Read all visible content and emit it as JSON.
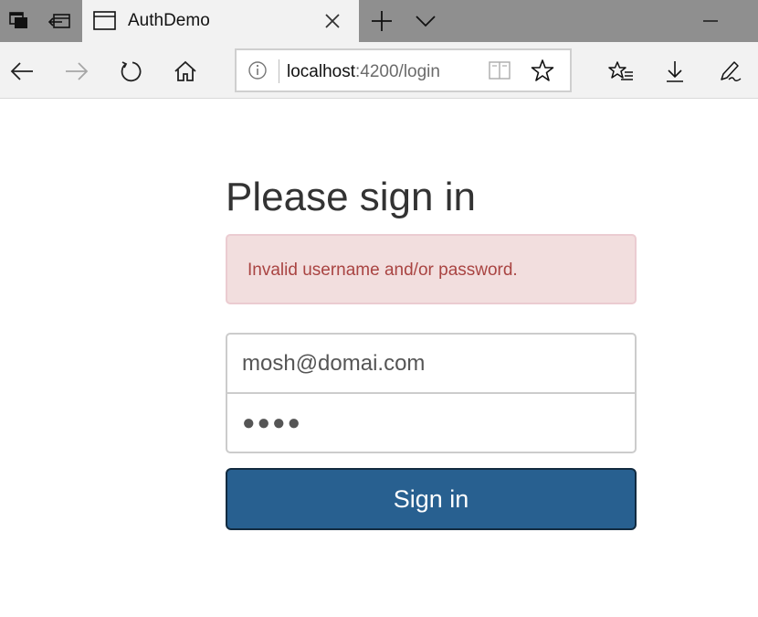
{
  "browser": {
    "tab": {
      "title": "AuthDemo"
    },
    "address": {
      "host": "localhost",
      "path": ":4200/login"
    },
    "icons": {
      "tabs_aside": "tabs-aside-icon",
      "set_aside": "set-tabs-aside-icon",
      "tab_page": "tab-page-icon",
      "close": "close-icon",
      "new_tab": "plus-icon",
      "tab_list": "chevron-down-icon",
      "minimize": "minimize-icon",
      "back": "back-arrow-icon",
      "forward": "forward-arrow-icon",
      "refresh": "refresh-icon",
      "home": "home-icon",
      "info": "info-icon",
      "reading_view": "reading-view-icon",
      "favorite": "star-icon",
      "favorites_hub": "favorites-list-icon",
      "downloads": "download-icon",
      "notes": "pen-icon"
    }
  },
  "page": {
    "heading": "Please sign in",
    "alert": {
      "message": "Invalid username and/or password.",
      "bg": "#f2dede",
      "text_color": "#a94442"
    },
    "form": {
      "email_value": "mosh@domai.com",
      "password_masked": "●●●●",
      "submit_label": "Sign in",
      "button_color": "#286090"
    }
  }
}
